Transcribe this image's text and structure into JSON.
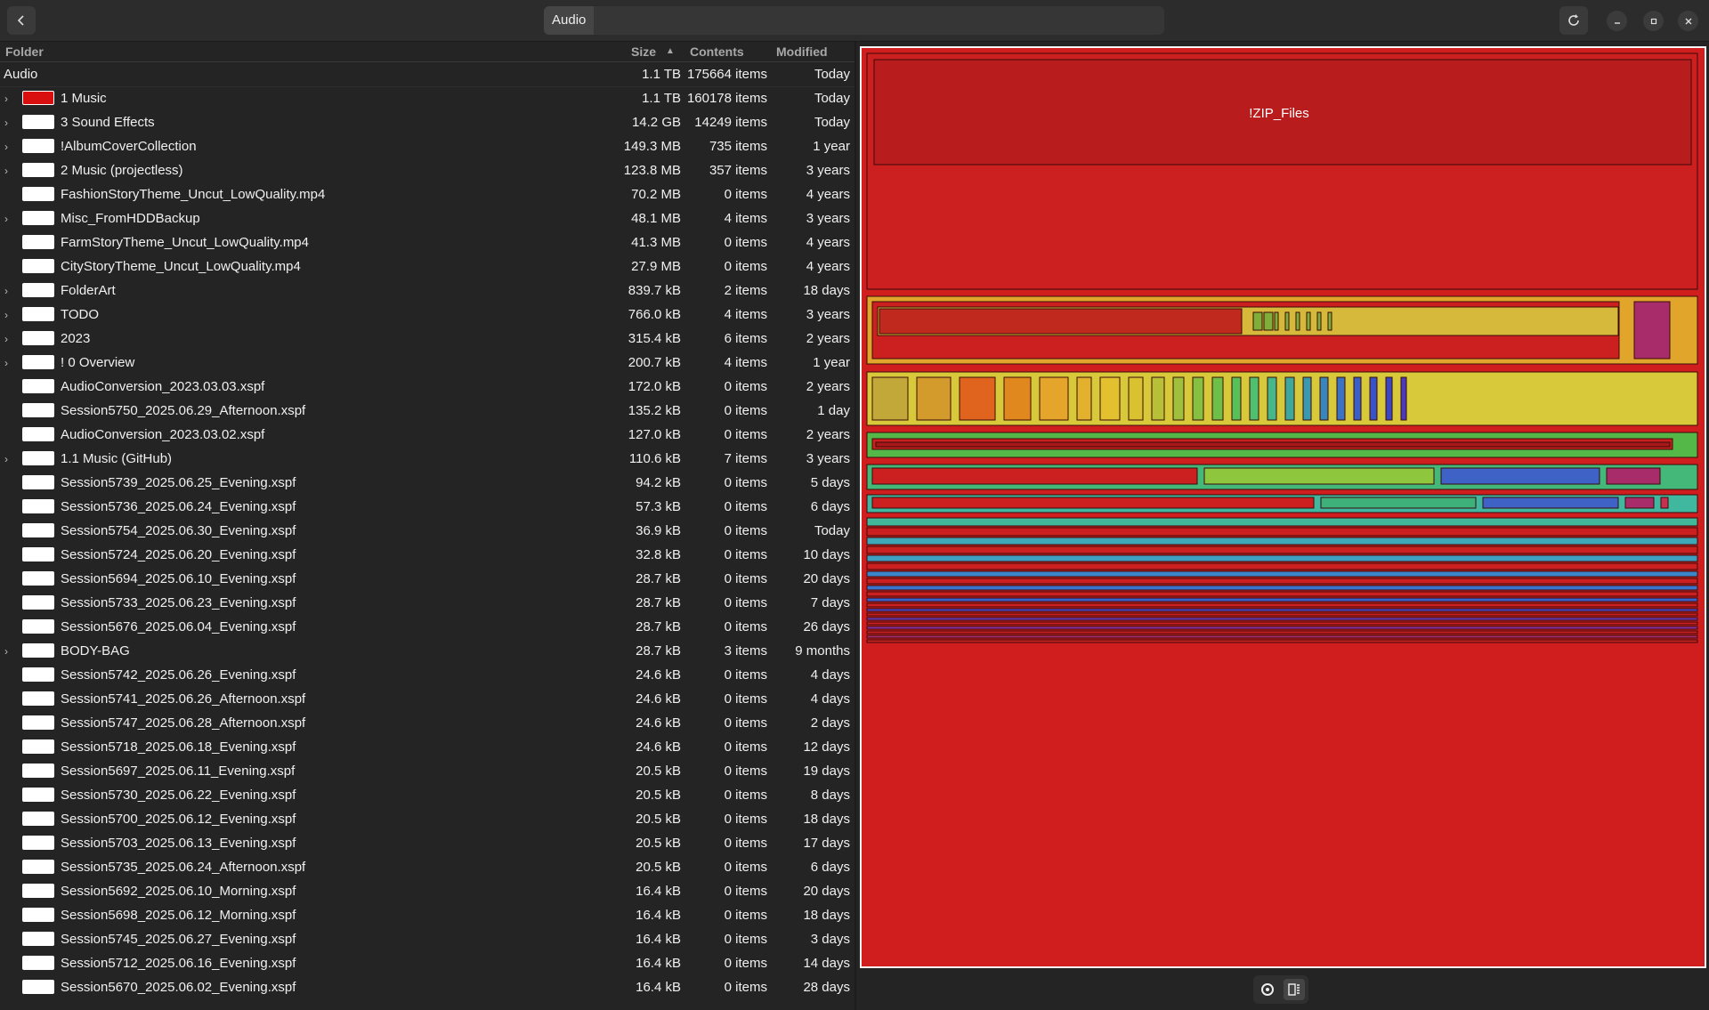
{
  "header": {
    "path_label": "Audio",
    "icons": {
      "back": "chevron-left-icon",
      "refresh": "refresh-icon",
      "minimize": "minimize-icon",
      "maximize": "maximize-icon",
      "close": "close-icon"
    }
  },
  "columns": {
    "folder": "Folder",
    "size": "Size",
    "contents": "Contents",
    "modified": "Modified",
    "sort_indicator": "^"
  },
  "root": {
    "name": "Audio",
    "size": "1.1 TB",
    "contents": "175664 items",
    "modified": "Today"
  },
  "rows": [
    {
      "name": "1 Music",
      "size": "1.1 TB",
      "contents": "160178 items",
      "modified": "Today",
      "expandable": true,
      "selected": true
    },
    {
      "name": "3 Sound Effects",
      "size": "14.2 GB",
      "contents": "14249 items",
      "modified": "Today",
      "expandable": true
    },
    {
      "name": "!AlbumCoverCollection",
      "size": "149.3 MB",
      "contents": "735 items",
      "modified": "1 year",
      "expandable": true
    },
    {
      "name": "2 Music (projectless)",
      "size": "123.8 MB",
      "contents": "357 items",
      "modified": "3 years",
      "expandable": true
    },
    {
      "name": "FashionStoryTheme_Uncut_LowQuality.mp4",
      "size": "70.2 MB",
      "contents": "0 items",
      "modified": "4 years",
      "expandable": false
    },
    {
      "name": "Misc_FromHDDBackup",
      "size": "48.1 MB",
      "contents": "4 items",
      "modified": "3 years",
      "expandable": true
    },
    {
      "name": "FarmStoryTheme_Uncut_LowQuality.mp4",
      "size": "41.3 MB",
      "contents": "0 items",
      "modified": "4 years",
      "expandable": false
    },
    {
      "name": "CityStoryTheme_Uncut_LowQuality.mp4",
      "size": "27.9 MB",
      "contents": "0 items",
      "modified": "4 years",
      "expandable": false
    },
    {
      "name": "FolderArt",
      "size": "839.7 kB",
      "contents": "2 items",
      "modified": "18 days",
      "expandable": true
    },
    {
      "name": "TODO",
      "size": "766.0 kB",
      "contents": "4 items",
      "modified": "3 years",
      "expandable": true
    },
    {
      "name": "2023",
      "size": "315.4 kB",
      "contents": "6 items",
      "modified": "2 years",
      "expandable": true
    },
    {
      "name": "! 0 Overview",
      "size": "200.7 kB",
      "contents": "4 items",
      "modified": "1 year",
      "expandable": true
    },
    {
      "name": "AudioConversion_2023.03.03.xspf",
      "size": "172.0 kB",
      "contents": "0 items",
      "modified": "2 years",
      "expandable": false
    },
    {
      "name": "Session5750_2025.06.29_Afternoon.xspf",
      "size": "135.2 kB",
      "contents": "0 items",
      "modified": "1 day",
      "expandable": false
    },
    {
      "name": "AudioConversion_2023.03.02.xspf",
      "size": "127.0 kB",
      "contents": "0 items",
      "modified": "2 years",
      "expandable": false
    },
    {
      "name": "1.1 Music (GitHub)",
      "size": "110.6 kB",
      "contents": "7 items",
      "modified": "3 years",
      "expandable": true
    },
    {
      "name": "Session5739_2025.06.25_Evening.xspf",
      "size": "94.2 kB",
      "contents": "0 items",
      "modified": "5 days",
      "expandable": false
    },
    {
      "name": "Session5736_2025.06.24_Evening.xspf",
      "size": "57.3 kB",
      "contents": "0 items",
      "modified": "6 days",
      "expandable": false
    },
    {
      "name": "Session5754_2025.06.30_Evening.xspf",
      "size": "36.9 kB",
      "contents": "0 items",
      "modified": "Today",
      "expandable": false
    },
    {
      "name": "Session5724_2025.06.20_Evening.xspf",
      "size": "32.8 kB",
      "contents": "0 items",
      "modified": "10 days",
      "expandable": false
    },
    {
      "name": "Session5694_2025.06.10_Evening.xspf",
      "size": "28.7 kB",
      "contents": "0 items",
      "modified": "20 days",
      "expandable": false
    },
    {
      "name": "Session5733_2025.06.23_Evening.xspf",
      "size": "28.7 kB",
      "contents": "0 items",
      "modified": "7 days",
      "expandable": false
    },
    {
      "name": "Session5676_2025.06.04_Evening.xspf",
      "size": "28.7 kB",
      "contents": "0 items",
      "modified": "26 days",
      "expandable": false
    },
    {
      "name": "BODY-BAG",
      "size": "28.7 kB",
      "contents": "3 items",
      "modified": "9 months",
      "expandable": true
    },
    {
      "name": "Session5742_2025.06.26_Evening.xspf",
      "size": "24.6 kB",
      "contents": "0 items",
      "modified": "4 days",
      "expandable": false
    },
    {
      "name": "Session5741_2025.06.26_Afternoon.xspf",
      "size": "24.6 kB",
      "contents": "0 items",
      "modified": "4 days",
      "expandable": false
    },
    {
      "name": "Session5747_2025.06.28_Afternoon.xspf",
      "size": "24.6 kB",
      "contents": "0 items",
      "modified": "2 days",
      "expandable": false
    },
    {
      "name": "Session5718_2025.06.18_Evening.xspf",
      "size": "24.6 kB",
      "contents": "0 items",
      "modified": "12 days",
      "expandable": false
    },
    {
      "name": "Session5697_2025.06.11_Evening.xspf",
      "size": "20.5 kB",
      "contents": "0 items",
      "modified": "19 days",
      "expandable": false
    },
    {
      "name": "Session5730_2025.06.22_Evening.xspf",
      "size": "20.5 kB",
      "contents": "0 items",
      "modified": "8 days",
      "expandable": false
    },
    {
      "name": "Session5700_2025.06.12_Evening.xspf",
      "size": "20.5 kB",
      "contents": "0 items",
      "modified": "18 days",
      "expandable": false
    },
    {
      "name": "Session5703_2025.06.13_Evening.xspf",
      "size": "20.5 kB",
      "contents": "0 items",
      "modified": "17 days",
      "expandable": false
    },
    {
      "name": "Session5735_2025.06.24_Afternoon.xspf",
      "size": "20.5 kB",
      "contents": "0 items",
      "modified": "6 days",
      "expandable": false
    },
    {
      "name": "Session5692_2025.06.10_Morning.xspf",
      "size": "16.4 kB",
      "contents": "0 items",
      "modified": "20 days",
      "expandable": false
    },
    {
      "name": "Session5698_2025.06.12_Morning.xspf",
      "size": "16.4 kB",
      "contents": "0 items",
      "modified": "18 days",
      "expandable": false
    },
    {
      "name": "Session5745_2025.06.27_Evening.xspf",
      "size": "16.4 kB",
      "contents": "0 items",
      "modified": "3 days",
      "expandable": false
    },
    {
      "name": "Session5712_2025.06.16_Evening.xspf",
      "size": "16.4 kB",
      "contents": "0 items",
      "modified": "14 days",
      "expandable": false
    },
    {
      "name": "Session5670_2025.06.02_Evening.xspf",
      "size": "16.4 kB",
      "contents": "0 items",
      "modified": "28 days",
      "expandable": false
    }
  ],
  "treemap": {
    "label": "!ZIP_Files",
    "colors": {
      "background": "#d01e1e",
      "border": "#f6f6f6",
      "zip": "#b91c1c",
      "accent_yellow": "#d6b83a",
      "accent_green": "#4ec05a",
      "accent_blue": "#3a5fcf",
      "accent_magenta": "#a82c6a"
    }
  },
  "footer": {
    "icons": [
      "ring-chart-icon",
      "treemap-icon"
    ]
  }
}
